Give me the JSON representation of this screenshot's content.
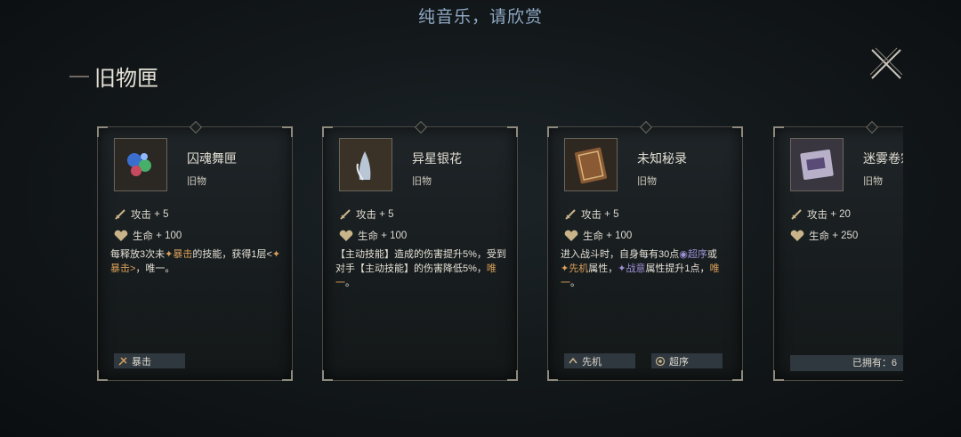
{
  "banner": "纯音乐，请欣赏",
  "title": "旧物匣",
  "cards": [
    {
      "name": "囚魂舞匣",
      "type": "旧物",
      "attack_label": "攻击",
      "attack_value": "+ 5",
      "hp_label": "生命",
      "hp_value": "+ 100",
      "desc_a": "每释放3次未",
      "desc_kw1": "暴击",
      "desc_b": "的技能，获得1层<",
      "desc_kw2": "暴击>",
      "desc_c": "，唯一。",
      "tags": [
        "暴击"
      ]
    },
    {
      "name": "异星银花",
      "type": "旧物",
      "attack_label": "攻击",
      "attack_value": "+ 5",
      "hp_label": "生命",
      "hp_value": "+ 100",
      "desc_a": "【主动技能】造成的伤害提升5%，受到对手【主动技能】的伤害降低5%，",
      "desc_kw1": "唯一",
      "desc_c": "。"
    },
    {
      "name": "未知秘录",
      "type": "旧物",
      "attack_label": "攻击",
      "attack_value": "+ 5",
      "hp_label": "生命",
      "hp_value": "+ 100",
      "desc_a": "进入战斗时，自身每有30点",
      "desc_kw1": "超序",
      "desc_b": "或",
      "desc_kw2": "先机",
      "desc_c": "属性，",
      "desc_kw3": "战意",
      "desc_d": "属性提升1点，",
      "desc_kw4": "唯一",
      "desc_e": "。",
      "tags": [
        "先机",
        "超序"
      ]
    },
    {
      "name": "迷雾卷宗",
      "type": "旧物",
      "attack_label": "攻击",
      "attack_value": "+ 20",
      "hp_label": "生命",
      "hp_value": "+ 250",
      "owned": "已拥有：6"
    }
  ]
}
